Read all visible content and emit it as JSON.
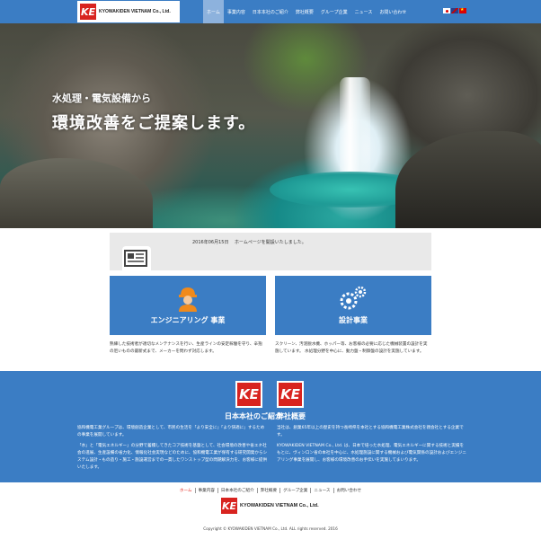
{
  "header": {
    "logo_mark": "KE",
    "logo_text": "KYOWAKIDEN VIETNAM Co., Ltd.",
    "nav": [
      {
        "label": "ホーム",
        "active": true
      },
      {
        "label": "事業内容",
        "active": false
      },
      {
        "label": "日本本社のご紹介",
        "active": false
      },
      {
        "label": "弊社概要",
        "active": false
      },
      {
        "label": "グループ企業",
        "active": false
      },
      {
        "label": "ニュース",
        "active": false
      },
      {
        "label": "お問い合わせ",
        "active": false
      }
    ]
  },
  "hero": {
    "subtitle": "水処理・電気設備から",
    "title": "環境改善をご提案します。"
  },
  "news": {
    "date": "2016年06月15日",
    "text": "ホームページを開設いたしました。"
  },
  "services": [
    {
      "title": "エンジニアリング 事業",
      "icon": "engineer-icon",
      "description": "熟練した技術者が適切なメンテナンスを行い、生産ラインの安定稼働を守り、辛抱の厄いものの最新式まで、メーカーを問わず対応します。"
    },
    {
      "title": "設計事業",
      "icon": "gears-icon",
      "description": "スクリーン、汚泥脱水機、ホッパー等、お客様の必要に応じた機械装置の設計を実施しています。 水処理分野を中心に、動力盤・制御盤の設計を実施しています。"
    }
  ],
  "about": [
    {
      "title": "日本本社のご紹介",
      "paragraphs": [
        "協和機電工業グループは、環境創造企業として、市民の生活を「より安全に」「より快適に」するための事業を展開しています。",
        "「水」と「電気エネルギー」の分野で蓄積してきたコア技術を基盤として、社会環境の改善や省エネ社会の進展、生産設備の省力化、情報化社会実現などのために、協和機電工業が保有する研究開発からシステム設計・もの造り・施工・施設運営までの一貫したワンストップ型の問題解決力を、お客様に提供いたします。"
      ]
    },
    {
      "title": "弊社概要",
      "paragraphs": [
        "当社は、創業65年以上の歴史を持つ長崎県を本社とする協和機電工業株式会社を親会社とする企業です。",
        "KYOWAKIDEN VIETNAM Co., Ltd. は、日本で培った水処理、電気エネルギーに関する技術と実績をもとに、ヴィンロン省の本社を中心に、水処理施設に関する機械および電気関係の設計およびエンジニアリング事業を展開し、お客様の環境改善のお手伝いを実施してまいります。"
      ]
    }
  ],
  "footer": {
    "nav": [
      {
        "label": "ホーム",
        "active": true
      },
      {
        "label": "事業内容",
        "active": false
      },
      {
        "label": "日本本社のご紹介",
        "active": false
      },
      {
        "label": "弊社概要",
        "active": false
      },
      {
        "label": "グループ企業",
        "active": false
      },
      {
        "label": "ニュース",
        "active": false
      },
      {
        "label": "お問い合わせ",
        "active": false
      }
    ],
    "logo_mark": "KE",
    "logo_text": "KYOWAKIDEN VIETNAM Co., Ltd.",
    "copyright": "Copyright © KYOWAKIDEN VIETNAM Co., Ltd. ALL rights reserved. 2016"
  },
  "colors": {
    "primary": "#3b7dc4",
    "accent": "#d8231f"
  }
}
